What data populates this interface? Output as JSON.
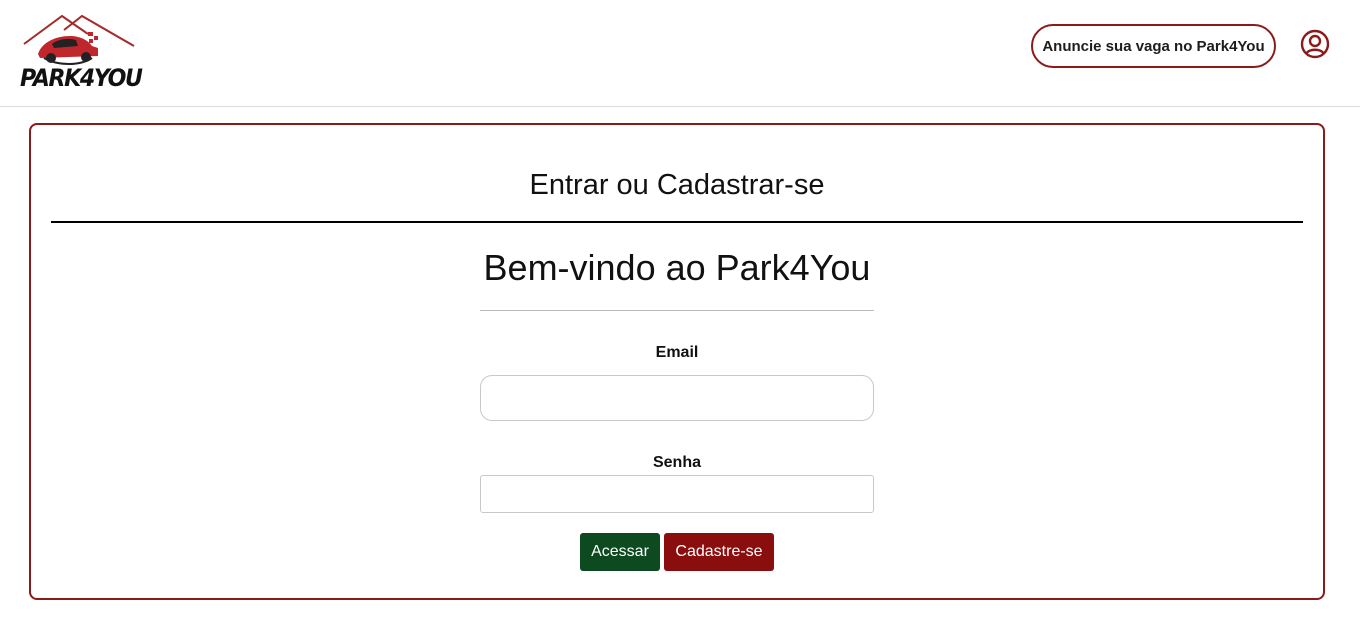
{
  "header": {
    "logo_text": "PARK4YOU",
    "advertise_label": "Anuncie sua vaga no Park4You",
    "user_icon": "user-circle-icon"
  },
  "card": {
    "title": "Entrar ou Cadastrar-se",
    "welcome": "Bem-vindo ao Park4You",
    "email_label": "Email",
    "email_value": "",
    "senha_label": "Senha",
    "senha_value": "",
    "acessar_label": "Acessar",
    "cadastre_label": "Cadastre-se"
  },
  "colors": {
    "brand_red": "#8b1a1a",
    "button_green": "#0d4a1f",
    "button_red": "#8b0e0e"
  }
}
